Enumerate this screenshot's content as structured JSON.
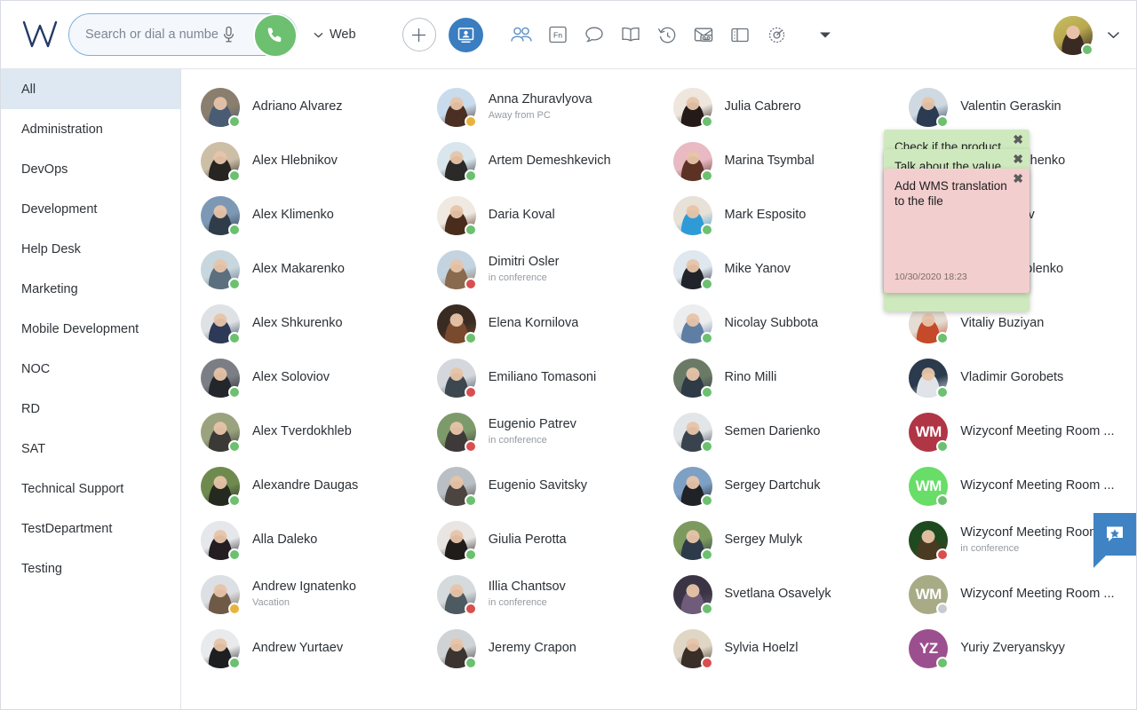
{
  "header": {
    "logo": "wizyconf-logo",
    "search": {
      "placeholder": "Search or dial a number",
      "value": "",
      "mic_icon": "microphone-icon",
      "call_icon": "phone-icon"
    },
    "mode_selector": {
      "label": "Web",
      "chevron": "chevron-down-icon"
    },
    "toolbar": [
      {
        "name": "add-button",
        "icon": "plus-icon",
        "label": "",
        "active": false
      },
      {
        "name": "contacts-tab",
        "icon": "contact-card-icon",
        "label": "",
        "active": true
      },
      {
        "name": "groups-tab",
        "icon": "people-icon",
        "label": "",
        "active": false
      },
      {
        "name": "fn-keys-tab",
        "icon": "fn-key-icon",
        "label": "Fn",
        "active": false
      },
      {
        "name": "chat-tab",
        "icon": "chat-bubble-icon",
        "label": "",
        "active": false
      },
      {
        "name": "phonebook-tab",
        "icon": "book-icon",
        "label": "",
        "active": false
      },
      {
        "name": "history-tab",
        "icon": "history-clock-icon",
        "label": "",
        "active": false
      },
      {
        "name": "voicemail-tab",
        "icon": "voicemail-icon",
        "label": "",
        "active": false
      },
      {
        "name": "panel-tab",
        "icon": "sidebar-panel-icon",
        "label": "",
        "active": false
      },
      {
        "name": "settings-tab",
        "icon": "gear-icon",
        "label": "",
        "active": false
      },
      {
        "name": "more-menu",
        "icon": "caret-down-icon",
        "label": "",
        "active": false
      }
    ],
    "user": {
      "status": "online",
      "chevron": "chevron-down-icon"
    }
  },
  "sidebar": {
    "items": [
      {
        "label": "All",
        "active": true
      },
      {
        "label": "Administration",
        "active": false
      },
      {
        "label": "DevOps",
        "active": false
      },
      {
        "label": "Development",
        "active": false
      },
      {
        "label": "Help Desk",
        "active": false
      },
      {
        "label": "Marketing",
        "active": false
      },
      {
        "label": "Mobile Development",
        "active": false
      },
      {
        "label": "NOC",
        "active": false
      },
      {
        "label": "RD",
        "active": false
      },
      {
        "label": "SAT",
        "active": false
      },
      {
        "label": "Technical Support",
        "active": false
      },
      {
        "label": "TestDepartment",
        "active": false
      },
      {
        "label": "Testing",
        "active": false
      }
    ]
  },
  "contacts": [
    {
      "name": "Adriano Alvarez",
      "status": "",
      "presence": "online",
      "avatar": "photo",
      "colors": [
        "#8a7f6e",
        "#4a5c74"
      ]
    },
    {
      "name": "Alex Hlebnikov",
      "status": "",
      "presence": "online",
      "avatar": "photo",
      "colors": [
        "#cdbfa6",
        "#272522"
      ]
    },
    {
      "name": "Alex Klimenko",
      "status": "",
      "presence": "online",
      "avatar": "photo",
      "colors": [
        "#7d98b4",
        "#2f3d4b"
      ]
    },
    {
      "name": "Alex Makarenko",
      "status": "",
      "presence": "online",
      "avatar": "photo",
      "colors": [
        "#c8d6dd",
        "#5b6f7f"
      ]
    },
    {
      "name": "Alex Shkurenko",
      "status": "",
      "presence": "online",
      "avatar": "photo",
      "colors": [
        "#dfe2e5",
        "#2c3a57"
      ]
    },
    {
      "name": "Alex Soloviov",
      "status": "",
      "presence": "online",
      "avatar": "photo",
      "colors": [
        "#7b7f85",
        "#23262b"
      ]
    },
    {
      "name": "Alex Tverdokhleb",
      "status": "",
      "presence": "online",
      "avatar": "photo",
      "colors": [
        "#9aa37e",
        "#3b3a36"
      ]
    },
    {
      "name": "Alexandre Daugas",
      "status": "",
      "presence": "online",
      "avatar": "photo",
      "colors": [
        "#6f8a4e",
        "#242a20"
      ]
    },
    {
      "name": "Alla Daleko",
      "status": "",
      "presence": "online",
      "avatar": "photo",
      "colors": [
        "#e5e7ea",
        "#241d22"
      ]
    },
    {
      "name": "Andrew Ignatenko",
      "status": "Vacation",
      "presence": "away",
      "avatar": "photo",
      "colors": [
        "#dcdfe3",
        "#6f5a48"
      ]
    },
    {
      "name": "Andrew Yurtaev",
      "status": "",
      "presence": "online",
      "avatar": "photo",
      "colors": [
        "#e8eaec",
        "#1e1f21"
      ]
    },
    {
      "name": "Anna Zhuravlyova",
      "status": "Away from PC",
      "presence": "away",
      "avatar": "photo",
      "colors": [
        "#c9dced",
        "#4a2f22"
      ]
    },
    {
      "name": "Artem Demeshkevich",
      "status": "",
      "presence": "online",
      "avatar": "photo",
      "colors": [
        "#d9e6ee",
        "#2b2a28"
      ]
    },
    {
      "name": "Daria Koval",
      "status": "",
      "presence": "online",
      "avatar": "photo",
      "colors": [
        "#efe9e2",
        "#4a2c1d"
      ]
    },
    {
      "name": "Dimitri Osler",
      "status": "in conference",
      "presence": "busy",
      "avatar": "photo",
      "colors": [
        "#c3d4e0",
        "#8a6a4e"
      ]
    },
    {
      "name": "Elena Kornilova",
      "status": "",
      "presence": "online",
      "avatar": "photo",
      "colors": [
        "#3a2b22",
        "#7a4a2e"
      ]
    },
    {
      "name": "Emiliano Tomasoni",
      "status": "",
      "presence": "busy",
      "avatar": "photo",
      "colors": [
        "#d4d8dc",
        "#3c4750"
      ]
    },
    {
      "name": "Eugenio Patrev",
      "status": "in conference",
      "presence": "busy",
      "avatar": "photo",
      "colors": [
        "#7d9b6a",
        "#3e3a3a"
      ]
    },
    {
      "name": "Eugenio Savitsky",
      "status": "",
      "presence": "online",
      "avatar": "photo",
      "colors": [
        "#b9bfc4",
        "#4b4440"
      ]
    },
    {
      "name": "Giulia Perotta",
      "status": "",
      "presence": "online",
      "avatar": "photo",
      "colors": [
        "#e8e5e2",
        "#201c1a"
      ]
    },
    {
      "name": "Illia Chantsov",
      "status": "in conference",
      "presence": "busy",
      "avatar": "photo",
      "colors": [
        "#d5dadd",
        "#4d5a62"
      ]
    },
    {
      "name": "Jeremy Crapon",
      "status": "",
      "presence": "online",
      "avatar": "photo",
      "colors": [
        "#cfd3d6",
        "#3b3431"
      ]
    },
    {
      "name": "Julia Cabrero",
      "status": "",
      "presence": "online",
      "avatar": "photo",
      "colors": [
        "#efe6dd",
        "#241a18"
      ]
    },
    {
      "name": "Marina Tsymbal",
      "status": "",
      "presence": "online",
      "avatar": "photo",
      "colors": [
        "#e9b9c4",
        "#5c3224"
      ]
    },
    {
      "name": "Mark Esposito",
      "status": "",
      "presence": "online",
      "avatar": "photo",
      "colors": [
        "#e7e1d8",
        "#2f9bd6"
      ]
    },
    {
      "name": "Mike Yanov",
      "status": "",
      "presence": "online",
      "avatar": "photo",
      "colors": [
        "#dfe7ef",
        "#20242a"
      ]
    },
    {
      "name": "Nicolay Subbota",
      "status": "",
      "presence": "online",
      "avatar": "photo",
      "colors": [
        "#ecedef",
        "#5f7ea4"
      ]
    },
    {
      "name": "Rino Milli",
      "status": "",
      "presence": "online",
      "avatar": "photo",
      "colors": [
        "#6a7a66",
        "#2e3a46"
      ]
    },
    {
      "name": "Semen Darienko",
      "status": "",
      "presence": "online",
      "avatar": "photo",
      "colors": [
        "#e3e6e8",
        "#38434d"
      ]
    },
    {
      "name": "Sergey Dartchuk",
      "status": "",
      "presence": "online",
      "avatar": "photo",
      "colors": [
        "#7ea0c4",
        "#1f2226"
      ]
    },
    {
      "name": "Sergey Mulyk",
      "status": "",
      "presence": "online",
      "avatar": "photo",
      "colors": [
        "#7d9a5e",
        "#2c3a4a"
      ]
    },
    {
      "name": "Svetlana Osavelyk",
      "status": "",
      "presence": "online",
      "avatar": "photo",
      "colors": [
        "#3a3444",
        "#6e5c7a"
      ]
    },
    {
      "name": "Sylvia Hoelzl",
      "status": "",
      "presence": "busy",
      "avatar": "photo",
      "colors": [
        "#e0d6c6",
        "#3a2e28"
      ]
    },
    {
      "name": "Valentin Geraskin",
      "status": "",
      "presence": "online",
      "avatar": "photo",
      "colors": [
        "#cfd9e2",
        "#2a3b52"
      ]
    },
    {
      "name": "Valeriy Tkachenko",
      "status": "",
      "presence": "online",
      "avatar": "photo",
      "colors": [
        "#d8dee4",
        "#2e4257"
      ]
    },
    {
      "name": "Victor Ivanov",
      "status": "",
      "presence": "online",
      "avatar": "photo",
      "colors": [
        "#b9c2ca",
        "#2c3744"
      ]
    },
    {
      "name": "Victoria Nikolenko",
      "status": "",
      "presence": "online",
      "avatar": "photo",
      "colors": [
        "#efe8df",
        "#b08a4e"
      ]
    },
    {
      "name": "Vitaliy Buziyan",
      "status": "",
      "presence": "online",
      "avatar": "photo",
      "colors": [
        "#e4ddd3",
        "#c44a2a"
      ]
    },
    {
      "name": "Vladimir Gorobets",
      "status": "",
      "presence": "online",
      "avatar": "photo",
      "colors": [
        "#2b3a4c",
        "#e0e4e8"
      ]
    },
    {
      "name": "Wizyconf Meeting Room ...",
      "status": "",
      "presence": "online",
      "avatar": "initials",
      "initials": "WM",
      "bg": "#b03545"
    },
    {
      "name": "Wizyconf Meeting Room ...",
      "status": "",
      "presence": "online",
      "avatar": "initials",
      "initials": "WM",
      "bg": "#68dd68"
    },
    {
      "name": "Wizyconf Meeting Room ...",
      "status": "in conference",
      "presence": "busy",
      "avatar": "photo",
      "colors": [
        "#1f4a1f",
        "#4a3a22"
      ]
    },
    {
      "name": "Wizyconf Meeting Room ...",
      "status": "",
      "presence": "offline",
      "avatar": "initials",
      "initials": "WM",
      "bg": "#a8ab86"
    },
    {
      "name": "Yuriy Zveryanskyy",
      "status": "",
      "presence": "online",
      "avatar": "initials",
      "initials": "YZ",
      "bg": "#9c4f8e"
    }
  ],
  "notes": [
    {
      "text": "Check if the product will...",
      "color": "#cfe9be",
      "close": "close-icon",
      "date": ""
    },
    {
      "text": "Talk about the value",
      "color": "#cfe9be",
      "close": "close-icon",
      "date": ""
    },
    {
      "text": "Add WMS translation to the file",
      "color": "#f3cece",
      "close": "close-icon",
      "date": "10/30/2020 18:23"
    }
  ],
  "feedback_widget": {
    "icon": "feedback-star-icon",
    "color": "#4083c4"
  }
}
